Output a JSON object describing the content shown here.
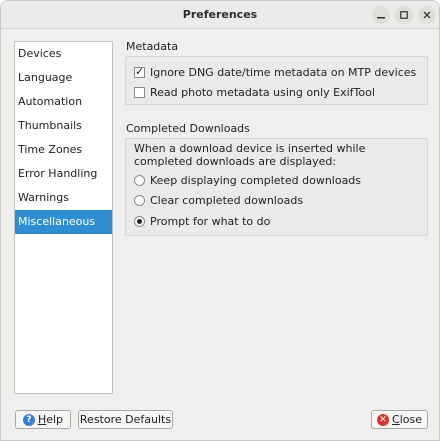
{
  "window": {
    "title": "Preferences"
  },
  "sidebar": {
    "items": [
      {
        "label": "Devices"
      },
      {
        "label": "Language"
      },
      {
        "label": "Automation"
      },
      {
        "label": "Thumbnails"
      },
      {
        "label": "Time Zones"
      },
      {
        "label": "Error Handling"
      },
      {
        "label": "Warnings"
      },
      {
        "label": "Miscellaneous",
        "selected": true
      }
    ]
  },
  "metadata": {
    "title": "Metadata",
    "options": [
      {
        "label": "Ignore DNG date/time metadata on MTP devices",
        "checked": true
      },
      {
        "label": "Read photo metadata using only ExifTool",
        "checked": false
      }
    ]
  },
  "completed_downloads": {
    "title": "Completed Downloads",
    "description": "When a download device is inserted while completed downloads are displayed:",
    "options": [
      {
        "label": "Keep displaying completed downloads",
        "selected": false
      },
      {
        "label": "Clear completed downloads",
        "selected": false
      },
      {
        "label": "Prompt for what to do",
        "selected": true
      }
    ]
  },
  "buttons": {
    "help_mnemonic": "H",
    "help_rest": "elp",
    "restore_label": "Restore Defaults",
    "close_mnemonic": "C",
    "close_rest": "lose"
  },
  "colors": {
    "selection": "#2f8ed1",
    "help_icon": "#3a7fd0",
    "close_icon": "#d9342b"
  }
}
